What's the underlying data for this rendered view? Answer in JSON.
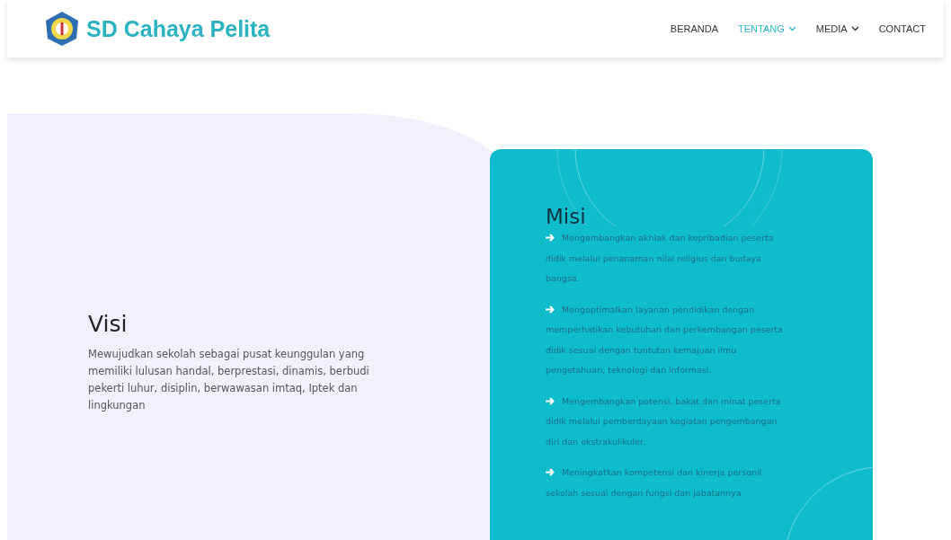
{
  "header": {
    "brand": "SD Cahaya Pelita",
    "nav": [
      {
        "label": "BERANDA",
        "selected": false,
        "dropdown": false
      },
      {
        "label": "TENTANG",
        "selected": true,
        "dropdown": true
      },
      {
        "label": "MEDIA",
        "selected": false,
        "dropdown": true
      },
      {
        "label": "CONTACT",
        "selected": false,
        "dropdown": false
      }
    ]
  },
  "visi": {
    "title": "Visi",
    "text": "Mewujudkan sekolah sebagai pusat keunggulan yang memiliki lulusan handal, berprestasi, dinamis, berbudi pekerti luhur, disiplin, berwawasan imtaq, Iptek dan lingkungan"
  },
  "misi": {
    "title": "Misi",
    "items": [
      "Mengembangkan akhlak dan kepribadian peserta didik melalui penanaman nilai religius dan budaya bangsa.",
      "Mengoptimalkan layanan pendidikan dengan memperhatikan kebutuhan dan perkembangan peserta didik sesuai dengan tuntutan kemajuan ilmu pengetahuan, teknologi dan informasi.",
      "Mengembangkan potensi, bakat dan minat peserta didik melalui pemberdayaan kegiatan pengembangan diri dan ekstrakulikuler.",
      "Meningkatkan kompetensi dan kinerja personil sekolah sesuai dengan fungsi dan jabatannya"
    ]
  }
}
